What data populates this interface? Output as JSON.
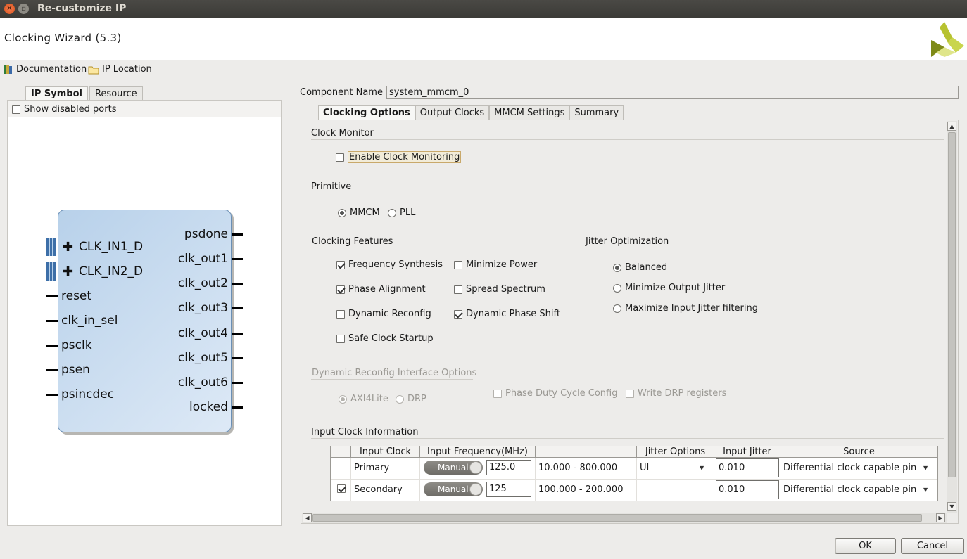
{
  "window": {
    "title": "Re-customize IP",
    "close_glyph": "✕",
    "max_glyph": "▫"
  },
  "header": {
    "title": "Clocking Wizard (5.3)",
    "logo_icon": "xilinx-logo-icon"
  },
  "links": {
    "documentation": "Documentation",
    "ip_location": "IP Location"
  },
  "left": {
    "tabs": [
      "IP Symbol",
      "Resource"
    ],
    "show_disabled_ports": {
      "label": "Show disabled ports",
      "checked": false
    },
    "symbol": {
      "inputs": [
        "CLK_IN1_D",
        "CLK_IN2_D",
        "reset",
        "clk_in_sel",
        "psclk",
        "psen",
        "psincdec"
      ],
      "outputs": [
        "psdone",
        "clk_out1",
        "clk_out2",
        "clk_out3",
        "clk_out4",
        "clk_out5",
        "clk_out6",
        "locked"
      ]
    }
  },
  "component": {
    "label": "Component Name",
    "value": "system_mmcm_0"
  },
  "tabs": [
    "Clocking Options",
    "Output Clocks",
    "MMCM Settings",
    "Summary"
  ],
  "clock_monitor": {
    "title": "Clock Monitor",
    "enable_label": "Enable Clock Monitoring",
    "enabled": false
  },
  "primitive": {
    "title": "Primitive",
    "options": [
      "MMCM",
      "PLL"
    ],
    "selected": "MMCM"
  },
  "features": {
    "title": "Clocking Features",
    "items": [
      {
        "label": "Frequency Synthesis",
        "checked": true
      },
      {
        "label": "Phase Alignment",
        "checked": true
      },
      {
        "label": "Dynamic Reconfig",
        "checked": false
      },
      {
        "label": "Safe Clock Startup",
        "checked": false
      },
      {
        "label": "Minimize Power",
        "checked": false
      },
      {
        "label": "Spread Spectrum",
        "checked": false
      },
      {
        "label": "Dynamic Phase Shift",
        "checked": true
      }
    ]
  },
  "jitter": {
    "title": "Jitter Optimization",
    "options": [
      "Balanced",
      "Minimize Output Jitter",
      "Maximize Input Jitter filtering"
    ],
    "selected": "Balanced"
  },
  "drp": {
    "title": "Dynamic Reconfig Interface Options",
    "interface_options": [
      "AXI4Lite",
      "DRP"
    ],
    "interface_selected": "AXI4Lite",
    "phase_duty_label": "Phase Duty Cycle Config",
    "write_drp_label": "Write DRP registers"
  },
  "input_clock": {
    "title": "Input Clock Information",
    "columns": [
      "",
      "Input Clock",
      "Input Frequency(MHz)",
      "",
      "Jitter Options",
      "Input Jitter",
      "Source"
    ],
    "rows": [
      {
        "checked": null,
        "name": "Primary",
        "mode": "Manual",
        "freq": "125.0",
        "range": "10.000 - 800.000",
        "jitter_opt": "UI",
        "input_jitter": "0.010",
        "source": "Differential clock capable pin"
      },
      {
        "checked": true,
        "name": "Secondary",
        "mode": "Manual",
        "freq": "125",
        "range": "100.000 - 200.000",
        "jitter_opt": "",
        "input_jitter": "0.010",
        "source": "Differential clock capable pin"
      }
    ]
  },
  "buttons": {
    "ok": "OK",
    "cancel": "Cancel"
  },
  "colors": {
    "symbol_fill": "#c6dbef",
    "symbol_border": "#6a8fb5",
    "bus": "#3d6fa8",
    "titlebar": "#3c3b37"
  }
}
